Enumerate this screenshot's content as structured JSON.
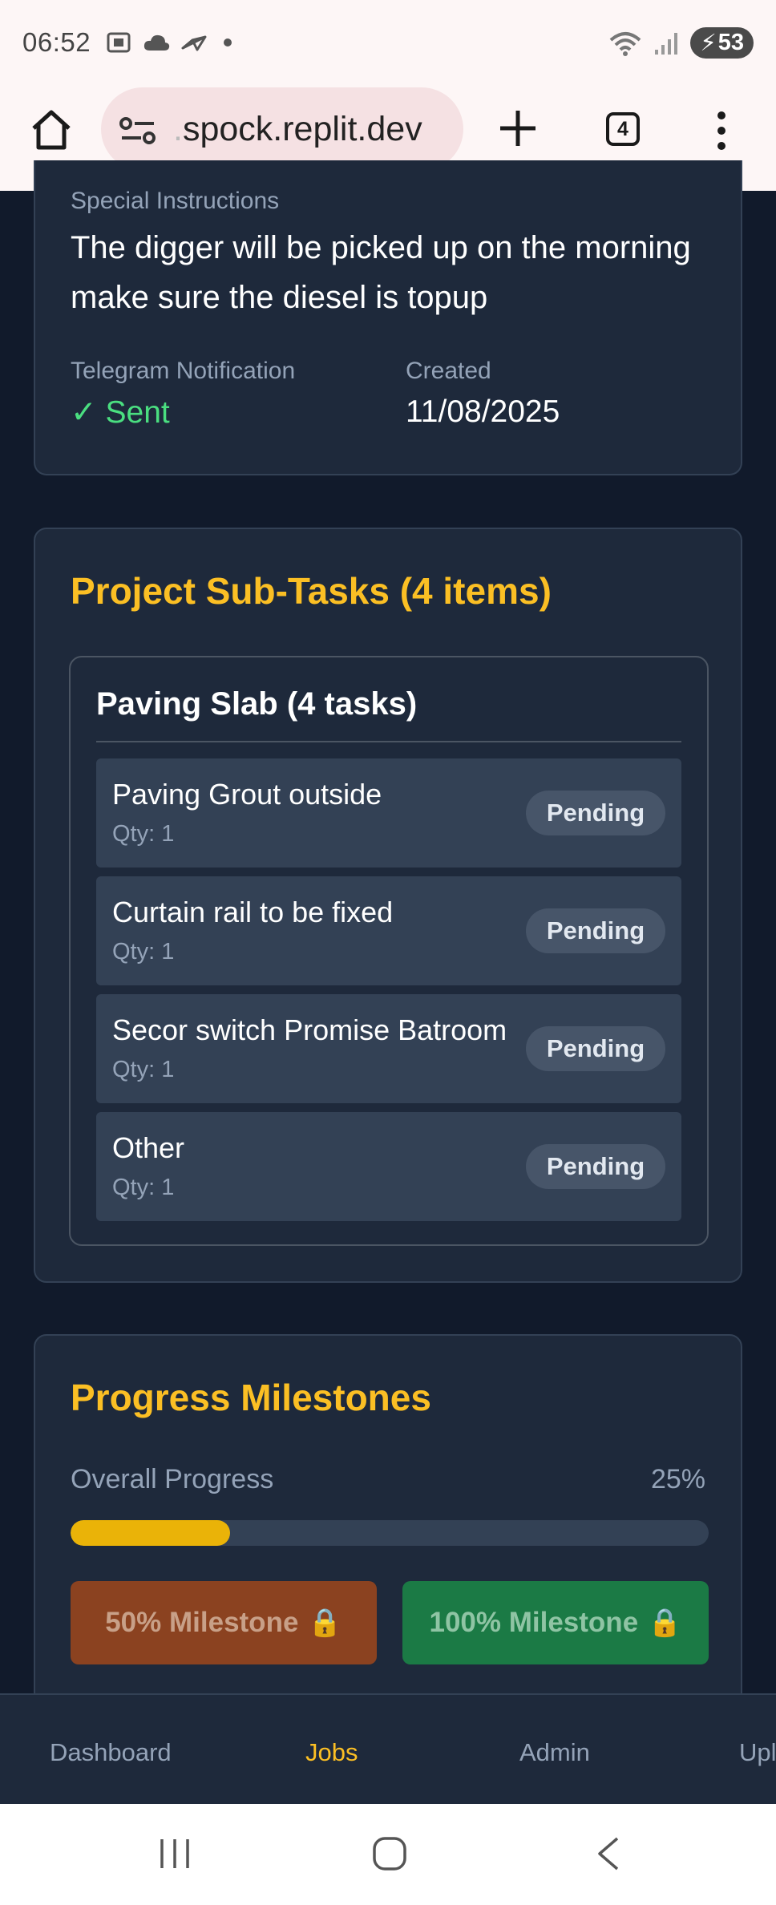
{
  "status_bar": {
    "time": "06:52",
    "battery_level": "53",
    "left_icons": [
      "screenshot-icon",
      "cloud-icon",
      "send-icon",
      "dot-icon"
    ],
    "right_icons": [
      "wifi-icon",
      "signal-icon",
      "battery-charging-icon"
    ]
  },
  "browser": {
    "url_faded": ".",
    "url": "spock.replit.dev",
    "tab_count": "4"
  },
  "job_details": {
    "special_instructions_label": "Special Instructions",
    "special_instructions": "The digger will be picked up on the morning make sure the diesel is topup",
    "telegram_label": "Telegram Notification",
    "telegram_check": "✓",
    "telegram_status": "Sent",
    "created_label": "Created",
    "created_date": "11/08/2025"
  },
  "subtasks": {
    "title": "Project Sub-Tasks (4 items)",
    "group_title": "Paving Slab (4 tasks)",
    "tasks": [
      {
        "name": "Paving Grout outside",
        "qty": "Qty: 1",
        "status": "Pending"
      },
      {
        "name": "Curtain rail to be fixed",
        "qty": "Qty: 1",
        "status": "Pending"
      },
      {
        "name": "Secor switch Promise Batroom",
        "qty": "Qty: 1",
        "status": "Pending"
      },
      {
        "name": "Other",
        "qty": "Qty: 1",
        "status": "Pending"
      }
    ]
  },
  "milestones": {
    "title": "Progress Milestones",
    "overall_label": "Overall Progress",
    "overall_percent_text": "25%",
    "overall_progress": 0.25,
    "milestone_50_label": "50% Milestone",
    "milestone_100_label": "100% Milestone",
    "lock_glyph": "🔒"
  },
  "bottom_nav": {
    "items": [
      "Dashboard",
      "Jobs",
      "Admin",
      "Upl"
    ],
    "active": "Jobs"
  },
  "colors": {
    "accent": "#fbbf24",
    "background": "#111a2b",
    "card": "#1e293b",
    "success": "#4ade80",
    "progress": "#eab308",
    "milestone_50": "#8b4220",
    "milestone_100": "#1b7a45"
  }
}
